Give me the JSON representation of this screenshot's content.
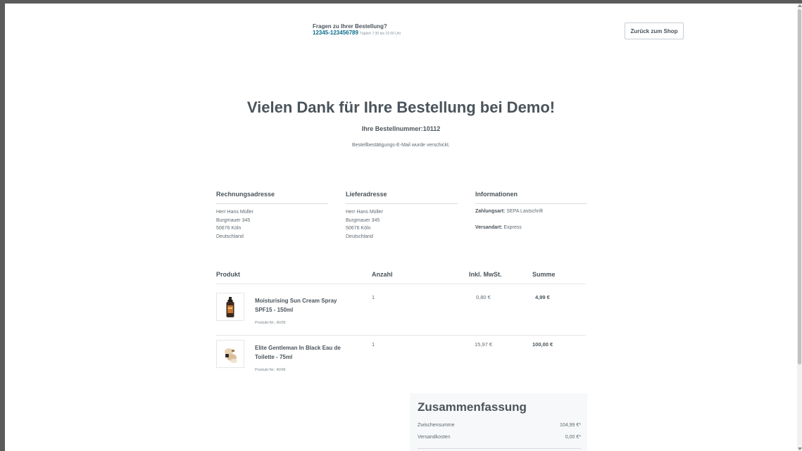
{
  "header": {
    "help_question": "Fragen zu Ihrer Bestellung?",
    "phone": "12345-123456789",
    "hours": "Täglich 7:30 bis 22:00 Uhr",
    "back_button": "Zurück zum Shop"
  },
  "confirmation": {
    "title": "Vielen Dank für Ihre Bestellung bei Demo!",
    "order_number": "Ihre Bestellnummer:10112",
    "mail_notice": "Bestellbestätigungs-E-Mail wurde verschickt."
  },
  "billing": {
    "heading": "Rechnungsadresse",
    "lines": [
      "Herr Hans Müller",
      "Burgmauer 345",
      "50676 Köln",
      "Deutschland"
    ]
  },
  "shipping": {
    "heading": "Lieferadresse",
    "lines": [
      "Herr Hans Müller",
      "Burgmauer 345",
      "50676 Köln",
      "Deutschland"
    ]
  },
  "information": {
    "heading": "Informationen",
    "payment_label": "Zahlungsart:",
    "payment_value": "SEPA Lastschrift",
    "shipping_label": "Versandart:",
    "shipping_value": "Express"
  },
  "table": {
    "headers": {
      "product": "Produkt",
      "quantity": "Anzahl",
      "vat": "Inkl. MwSt.",
      "total": "Summe"
    },
    "items": [
      {
        "name_line1": "Moisturising Sun Cream Spray",
        "name_line2": "SPF15 - 150ml",
        "product_no": "Produkt-Nr.: AV05",
        "quantity": "1",
        "vat": "0,80 €",
        "total": "4,99 €"
      },
      {
        "name_line1": "Elite Gentleman In Black Eau de",
        "name_line2": "Toilette - 75ml",
        "product_no": "Produkt-Nr.: AV06",
        "quantity": "1",
        "vat": "15,97 €",
        "total": "100,00 €"
      }
    ]
  },
  "summary": {
    "title": "Zusammenfassung",
    "subtotal_label": "Zwischensumme",
    "subtotal_value": "104,99 €*",
    "shipping_label": "Versandkosten",
    "shipping_value": "0,00 €*"
  }
}
